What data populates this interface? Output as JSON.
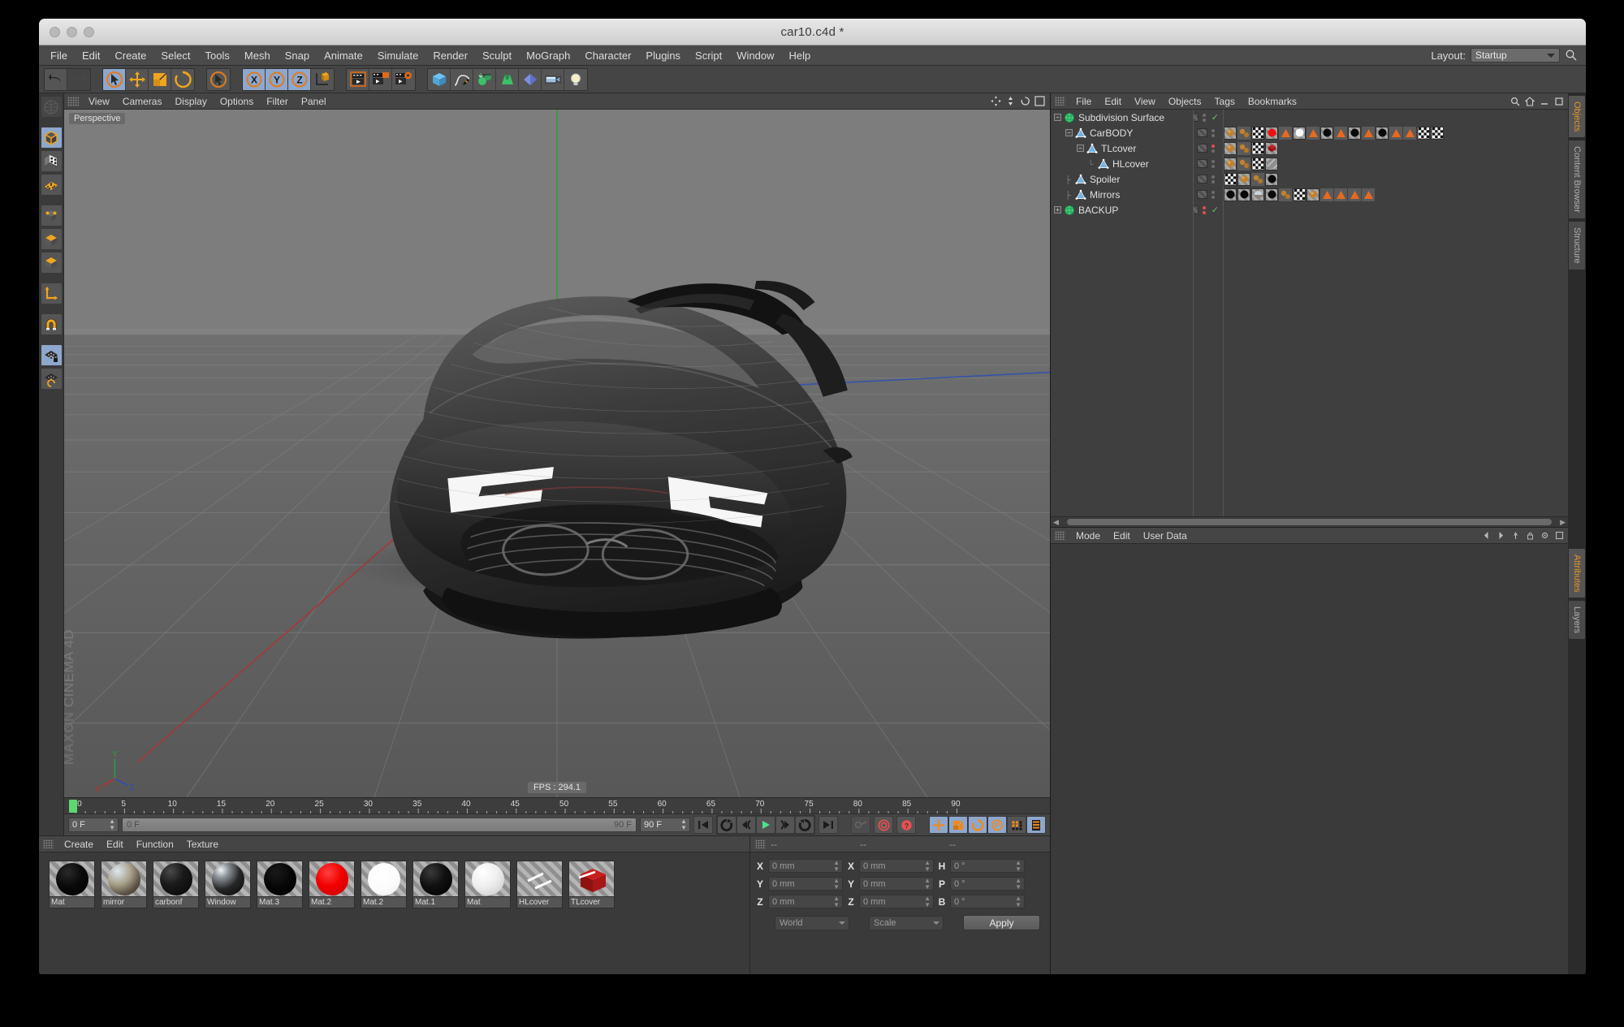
{
  "window": {
    "title": "car10.c4d *",
    "traffic_lights": [
      "close",
      "minimize",
      "zoom"
    ]
  },
  "menubar": {
    "items": [
      "File",
      "Edit",
      "Create",
      "Select",
      "Tools",
      "Mesh",
      "Snap",
      "Animate",
      "Simulate",
      "Render",
      "Sculpt",
      "MoGraph",
      "Character",
      "Plugins",
      "Script",
      "Window",
      "Help"
    ],
    "layout_label": "Layout:",
    "layout_value": "Startup",
    "search_icon": "magnifier-icon"
  },
  "main_toolbar": {
    "groups": [
      {
        "name": "undo-redo",
        "buttons": [
          {
            "icon": "undo-icon",
            "label": "Undo",
            "state": "enabled"
          },
          {
            "icon": "redo-icon",
            "label": "Redo",
            "state": "disabled"
          }
        ]
      },
      {
        "name": "transform-tools",
        "buttons": [
          {
            "icon": "live-selection-icon",
            "label": "Live Selection",
            "state": "selected"
          },
          {
            "icon": "move-icon",
            "label": "Move",
            "state": "enabled"
          },
          {
            "icon": "scale-icon",
            "label": "Scale",
            "state": "enabled"
          },
          {
            "icon": "rotate-icon",
            "label": "Rotate",
            "state": "enabled"
          }
        ]
      },
      {
        "name": "cursor-group",
        "buttons": [
          {
            "icon": "select-cursor-icon",
            "label": "Select",
            "state": "enabled"
          }
        ]
      },
      {
        "name": "axis-locks",
        "buttons": [
          {
            "icon": "x-axis-icon",
            "label": "X",
            "state": "selected"
          },
          {
            "icon": "y-axis-icon",
            "label": "Y",
            "state": "selected"
          },
          {
            "icon": "z-axis-icon",
            "label": "Z",
            "state": "selected"
          },
          {
            "icon": "world-axis-icon",
            "label": "World / Object",
            "state": "enabled"
          }
        ]
      },
      {
        "name": "render-group",
        "buttons": [
          {
            "icon": "render-view-icon",
            "label": "Render View",
            "state": "enabled"
          },
          {
            "icon": "render-region-icon",
            "label": "Render Region",
            "state": "enabled"
          },
          {
            "icon": "render-settings-icon",
            "label": "Render Settings",
            "state": "enabled"
          }
        ]
      },
      {
        "name": "object-group",
        "buttons": [
          {
            "icon": "cube-primitive-icon",
            "label": "Cube",
            "state": "enabled"
          },
          {
            "icon": "spline-pen-icon",
            "label": "Spline",
            "state": "enabled"
          },
          {
            "icon": "generator-icon",
            "label": "Generators",
            "state": "enabled"
          },
          {
            "icon": "deformer-icon",
            "label": "Deformers",
            "state": "enabled"
          },
          {
            "icon": "environment-icon",
            "label": "Environment",
            "state": "enabled"
          },
          {
            "icon": "camera-icon",
            "label": "Camera",
            "state": "enabled"
          },
          {
            "icon": "light-icon",
            "label": "Light",
            "state": "enabled"
          }
        ]
      }
    ]
  },
  "left_toolbar": {
    "buttons": [
      {
        "icon": "make-editable-icon",
        "label": "Make Editable",
        "state": "disabled"
      },
      {
        "icon": "model-mode-icon",
        "label": "Model Mode",
        "state": "selected"
      },
      {
        "icon": "texture-mode-icon",
        "label": "Texture Mode",
        "state": "enabled"
      },
      {
        "icon": "points-mode-icon",
        "label": "Points Mode",
        "state": "enabled"
      },
      {
        "icon": "edges-mode-icon",
        "label": "Edges Mode",
        "state": "enabled"
      },
      {
        "icon": "polygons-mode-icon",
        "label": "Polygons Mode",
        "state": "enabled"
      },
      {
        "icon": "axis-mode-icon",
        "label": "Enable Axis",
        "state": "enabled"
      },
      {
        "icon": "magnet-icon",
        "label": "Magnet",
        "state": "enabled"
      },
      {
        "icon": "workplane-lock-icon",
        "label": "Lock Workplane",
        "state": "selected"
      },
      {
        "icon": "workplane-rotate-icon",
        "label": "Rotate Workplane",
        "state": "enabled"
      }
    ]
  },
  "viewport": {
    "menu": [
      "View",
      "Cameras",
      "Display",
      "Options",
      "Filter",
      "Panel"
    ],
    "view_label": "Perspective",
    "fps": "FPS : 294.1",
    "watermark_line1": "MAXON",
    "watermark_line2": "CINEMA 4D",
    "header_icons": [
      "pan-icon",
      "zoom-icon",
      "rotate-view-icon",
      "maximize-view-icon"
    ]
  },
  "timeline": {
    "ticks": [
      0,
      5,
      10,
      15,
      20,
      25,
      30,
      35,
      40,
      45,
      50,
      55,
      60,
      65,
      70,
      75,
      80,
      85,
      90
    ],
    "playhead_frame": 0,
    "current_frame_field": "0 F",
    "current_frame_right": "0 F",
    "range_start": "0 F",
    "range_end": "90 F",
    "preview_end": "90 F",
    "transport": [
      {
        "icon": "go-to-start-icon",
        "label": "Go To Start"
      },
      {
        "icon": "previous-key-icon",
        "label": "Go To Previous Key"
      },
      {
        "icon": "step-back-icon",
        "label": "Go To Previous Frame"
      },
      {
        "icon": "play-icon",
        "label": "Play Forwards"
      },
      {
        "icon": "step-forward-icon",
        "label": "Go To Next Frame"
      },
      {
        "icon": "next-key-icon",
        "label": "Go To Next Key"
      },
      {
        "icon": "go-to-end-icon",
        "label": "Go To End"
      }
    ],
    "record_tools": [
      {
        "icon": "autokey-icon",
        "label": "Autokeying",
        "state": "disabled"
      },
      {
        "icon": "record-active-icon",
        "label": "Record Active Objects",
        "state": "enabled"
      },
      {
        "icon": "keyframe-help-icon",
        "label": "Keyframe Selection",
        "state": "enabled"
      }
    ],
    "param_tools": [
      {
        "icon": "position-key-icon",
        "label": "Position",
        "state": "selected"
      },
      {
        "icon": "scale-key-icon",
        "label": "Scale",
        "state": "selected"
      },
      {
        "icon": "rotation-key-icon",
        "label": "Rotation",
        "state": "selected"
      },
      {
        "icon": "param-key-icon",
        "label": "Parameter",
        "state": "selected"
      },
      {
        "icon": "point-level-anim-icon",
        "label": "PLA",
        "state": "selected"
      },
      {
        "icon": "timeline-icon",
        "label": "Timeline",
        "state": "selected"
      }
    ]
  },
  "object_manager": {
    "menu": [
      "File",
      "Edit",
      "View",
      "Objects",
      "Tags",
      "Bookmarks"
    ],
    "header_icons": [
      "search-icon",
      "home-icon",
      "minimize-icon",
      "maximize-icon"
    ],
    "rows": [
      {
        "name": "Subdivision Surface",
        "depth": 0,
        "icon": "subdivision-surface-icon",
        "expander": "minus",
        "dot_state": "none",
        "visible_check": true,
        "tags": []
      },
      {
        "name": "CarBODY",
        "depth": 1,
        "icon": "polygon-object-icon",
        "expander": "minus",
        "dot_state": "gray",
        "visible_check": false,
        "tags": [
          "material-brown",
          "material-spheres",
          "checker-material",
          "red-material",
          "orange-triangle",
          "white-material",
          "orange-triangle",
          "black-material",
          "orange-triangle",
          "black-material",
          "orange-triangle",
          "black-material",
          "orange-triangle",
          "orange-triangle",
          "checker-material",
          "checker-material"
        ]
      },
      {
        "name": "TLcover",
        "depth": 2,
        "icon": "polygon-object-icon",
        "expander": "minus",
        "dot_state": "red",
        "visible_check": false,
        "tags": [
          "material-brown",
          "material-spheres",
          "checker-material",
          "red-cube-material"
        ]
      },
      {
        "name": "HLcover",
        "depth": 3,
        "icon": "polygon-object-icon",
        "expander": "none",
        "dot_state": "gray",
        "visible_check": false,
        "tags": [
          "material-brown",
          "material-spheres",
          "checker-material",
          "hatched-material"
        ]
      },
      {
        "name": "Spoiler",
        "depth": 1,
        "icon": "polygon-object-icon",
        "expander": "none",
        "dot_state": "gray",
        "visible_check": false,
        "tags": [
          "checker-material",
          "material-brown",
          "material-spheres",
          "black-material"
        ]
      },
      {
        "name": "Mirrors",
        "depth": 1,
        "icon": "polygon-object-icon",
        "expander": "none",
        "dot_state": "gray",
        "visible_check": false,
        "tags": [
          "black-material",
          "black-material",
          "chrome-material",
          "black-material",
          "material-spheres",
          "checker-material",
          "material-brown",
          "orange-triangle",
          "orange-triangle",
          "orange-triangle",
          "orange-triangle"
        ]
      },
      {
        "name": "BACKUP",
        "depth": 0,
        "icon": "subdivision-surface-icon",
        "expander": "plus",
        "dot_state": "red",
        "visible_check": true,
        "tags": []
      }
    ]
  },
  "attributes_manager": {
    "menu": [
      "Mode",
      "Edit",
      "User Data"
    ],
    "header_icons": [
      "back-icon",
      "forward-icon",
      "pin-icon",
      "lock-icon",
      "settings-icon",
      "maximize-icon"
    ]
  },
  "right_tabs": {
    "upper": [
      {
        "label": "Objects",
        "active": true
      },
      {
        "label": "Content Browser",
        "active": false
      },
      {
        "label": "Structure",
        "active": false
      }
    ],
    "lower": [
      {
        "label": "Attributes",
        "active": true
      },
      {
        "label": "Layers",
        "active": false
      }
    ]
  },
  "material_manager": {
    "menu": [
      "Create",
      "Edit",
      "Function",
      "Texture"
    ],
    "materials": [
      {
        "name": "Mat",
        "type": "black",
        "color": "#050505"
      },
      {
        "name": "mirror",
        "type": "chrome",
        "color": "#a89a85"
      },
      {
        "name": "carbonf",
        "type": "dark-gloss",
        "color": "#131313"
      },
      {
        "name": "Window",
        "type": "chrome-dark",
        "color": "#1a1a1a"
      },
      {
        "name": "Mat.3",
        "type": "black",
        "color": "#030303"
      },
      {
        "name": "Mat.2",
        "type": "red",
        "color": "#ef0b0b"
      },
      {
        "name": "Mat.2",
        "type": "white",
        "color": "#fcfcfc"
      },
      {
        "name": "Mat.1",
        "type": "black-soft",
        "color": "#0d0d0d"
      },
      {
        "name": "Mat",
        "type": "white-soft",
        "color": "#e9e9e9"
      },
      {
        "name": "HLcover",
        "type": "transparent",
        "color": "#cfcfcf"
      },
      {
        "name": "TLcover",
        "type": "red-cube",
        "color": "#a81414"
      }
    ]
  },
  "coordinates": {
    "header_labels": [
      "--",
      "--",
      "--"
    ],
    "position": [
      {
        "axis": "X",
        "value": "0 mm"
      },
      {
        "axis": "Y",
        "value": "0 mm"
      },
      {
        "axis": "Z",
        "value": "0 mm"
      }
    ],
    "size": [
      {
        "axis": "X",
        "value": "0 mm"
      },
      {
        "axis": "Y",
        "value": "0 mm"
      },
      {
        "axis": "Z",
        "value": "0 mm"
      }
    ],
    "rotation": [
      {
        "axis": "H",
        "value": "0 °"
      },
      {
        "axis": "P",
        "value": "0 °"
      },
      {
        "axis": "B",
        "value": "0 °"
      }
    ],
    "coord_system": "World",
    "size_mode": "Scale",
    "apply_label": "Apply"
  },
  "colors": {
    "accent_orange": "#e99422",
    "selected_blue": "#8ea7cc",
    "panel_bg": "#3a3a3a",
    "toolbar_bg": "#454545",
    "viewport_bg": "#6e6e6e",
    "green_check": "#5ec75e",
    "red_dot": "#e05050"
  }
}
